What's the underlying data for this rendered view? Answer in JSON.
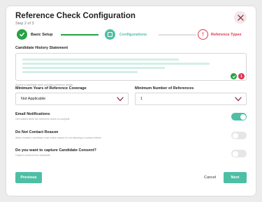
{
  "dialog": {
    "title": "Reference Check Configuration",
    "subtitle": "Step 2 of 3"
  },
  "colors": {
    "accent": "#4dbfa5",
    "done_green": "#25a244",
    "alert_red": "#e3324f"
  },
  "stepper": {
    "steps": [
      {
        "label": "Basic Setup",
        "state": "complete",
        "icon": "check-icon"
      },
      {
        "label": "Configurations",
        "state": "current",
        "icon": "square-icon"
      },
      {
        "label": "Reference Types",
        "state": "error",
        "icon": "exclamation-icon"
      }
    ]
  },
  "candidate_history": {
    "label": "Candidate History Statement",
    "help": "Shown to candidate when providing reference details",
    "status_count": "1"
  },
  "min_years": {
    "label": "Minimum Years of Reference Coverage",
    "value": "Not Applicable"
  },
  "min_refs": {
    "label": "Minimum Number of References",
    "value": "1"
  },
  "toggles": [
    {
      "label": "Email Notifications",
      "help": "Get notified when the reference check is complete",
      "on": true
    },
    {
      "label": "Do Not Contact Reason",
      "help": "When enabled, candidate must select reason for not allowing to contact referee",
      "on": false
    },
    {
      "label": "Do you want to capture Candidate Consent?",
      "help": "Capture consent from candidate",
      "on": false
    }
  ],
  "footer": {
    "previous_label": "Previous",
    "cancel_label": "Cancel",
    "next_label": "Next"
  }
}
